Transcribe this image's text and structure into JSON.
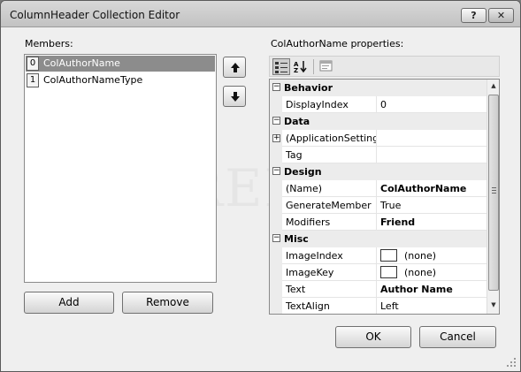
{
  "window": {
    "title": "ColumnHeader Collection Editor",
    "help_label": "?",
    "close_label": "✕"
  },
  "members": {
    "label": "Members:",
    "items": [
      {
        "index": "0",
        "label": "ColAuthorName",
        "selected": true
      },
      {
        "index": "1",
        "label": "ColAuthorNameType",
        "selected": false
      }
    ],
    "add_label": "Add",
    "remove_label": "Remove"
  },
  "properties": {
    "label": "ColAuthorName properties:",
    "categories": [
      {
        "name": "Behavior",
        "expander": "−",
        "rows": [
          {
            "name": "DisplayIndex",
            "value": "0",
            "bold": false
          }
        ]
      },
      {
        "name": "Data",
        "expander": "−",
        "rows": [
          {
            "name": "(ApplicationSetting",
            "value": "",
            "expander": "+",
            "bold": false
          },
          {
            "name": "Tag",
            "value": "",
            "bold": false
          }
        ]
      },
      {
        "name": "Design",
        "expander": "−",
        "rows": [
          {
            "name": "(Name)",
            "value": "ColAuthorName",
            "bold": true
          },
          {
            "name": "GenerateMember",
            "value": "True",
            "bold": false
          },
          {
            "name": "Modifiers",
            "value": "Friend",
            "bold": true
          }
        ]
      },
      {
        "name": "Misc",
        "expander": "−",
        "rows": [
          {
            "name": "ImageIndex",
            "value": "(none)",
            "swatch": true,
            "bold": false
          },
          {
            "name": "ImageKey",
            "value": "(none)",
            "swatch": true,
            "bold": false
          },
          {
            "name": "Text",
            "value": "Author Name",
            "bold": true
          },
          {
            "name": "TextAlign",
            "value": "Left",
            "bold": false
          }
        ]
      }
    ]
  },
  "footer": {
    "ok_label": "OK",
    "cancel_label": "Cancel"
  },
  "icons": {
    "up": "arrow-up-icon",
    "down": "arrow-down-icon",
    "categorized": "categorized-icon",
    "alphabetical": "alphabetical-sort-icon",
    "property_pages": "property-pages-icon"
  }
}
